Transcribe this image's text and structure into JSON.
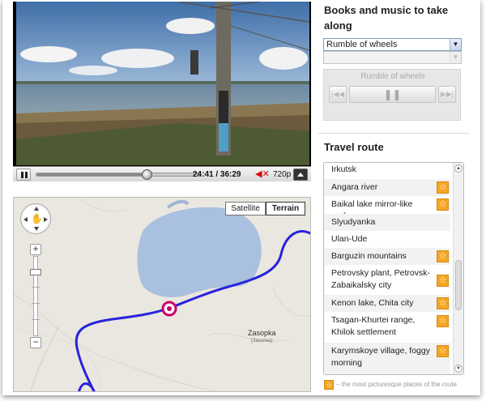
{
  "video": {
    "elapsed": "24:41",
    "duration": "36:29",
    "progress_fraction": 0.68,
    "quality": "720p"
  },
  "map": {
    "maptype": {
      "satellite": "Satellite",
      "terrain": "Terrain",
      "selected": "Terrain"
    },
    "town_label": "Zasopka",
    "town_sub": "(Засопка)"
  },
  "books": {
    "title": "Books and music to take along",
    "selected_album": "Rumble of wheels",
    "second_select": "",
    "player_track": "Rumble of wheels"
  },
  "route": {
    "title": "Travel route",
    "items": [
      {
        "label": "Irkutsk",
        "star": false
      },
      {
        "label": "Angara river",
        "star": true
      },
      {
        "label": "Baikal lake mirror-like surface",
        "star": true
      },
      {
        "label": "Slyudyanka",
        "star": false
      },
      {
        "label": "Ulan-Ude",
        "star": false
      },
      {
        "label": "Barguzin mountains",
        "star": true
      },
      {
        "label": "Petrovsky plant, Petrovsk-Zabaikalsky city",
        "star": true
      },
      {
        "label": "Kenon lake, Chita city",
        "star": true
      },
      {
        "label": "Tsagan-Khurtei range, Khilok settlement",
        "star": true
      },
      {
        "label": "Karymskoye village, foggy morning",
        "star": true
      }
    ],
    "legend": "– the most picturesque places of the route"
  },
  "colors": {
    "star": "#f5a623",
    "route_line": "#2020e0",
    "lake": "#a9c0de",
    "marker": "#cc0066"
  }
}
